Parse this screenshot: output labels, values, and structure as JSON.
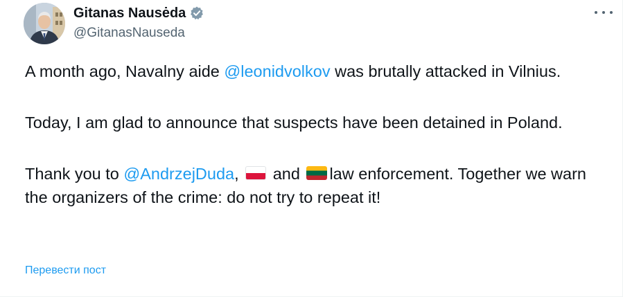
{
  "author": {
    "display_name": "Gitanas Nausėda",
    "handle": "@GitanasNauseda",
    "verified": true,
    "verified_color": "#829aab"
  },
  "menu": {
    "icon": "more-horizontal-icon"
  },
  "post": {
    "p1_text_a": "A month ago, Navalny aide ",
    "p1_mention": "@leonidvolkov",
    "p1_text_b": " was brutally attacked in Vilnius.",
    "p2_text": "Today, I am glad to announce that suspects have been detained in Poland.",
    "p3_text_a": "Thank you to ",
    "p3_mention": "@AndrzejDuda",
    "p3_text_b": ", ",
    "p3_flag_poland": "poland-flag-emoji",
    "p3_text_c": " and ",
    "p3_flag_lithuania": "lithuania-flag-emoji",
    "p3_text_d": "law enforcement. Together we warn the organizers of the crime: do not try to repeat it!"
  },
  "translate_label": "Перевести пост",
  "colors": {
    "text": "#0f1419",
    "secondary": "#536471",
    "link": "#1d9bf0",
    "border": "#eff3f4"
  }
}
